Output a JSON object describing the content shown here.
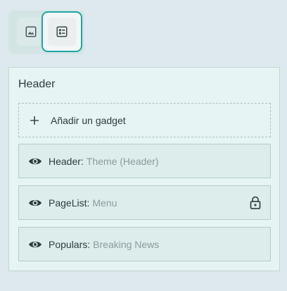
{
  "toolbar": {
    "buttons": [
      {
        "icon": "image-icon"
      },
      {
        "icon": "layout-icon",
        "selected": true
      }
    ]
  },
  "section": {
    "title": "Header",
    "add_gadget_label": "Añadir un gadget",
    "gadgets": [
      {
        "name": "Header:",
        "subtitle": "Theme (Header)",
        "visible": true,
        "locked": false
      },
      {
        "name": "PageList:",
        "subtitle": "Menu",
        "visible": true,
        "locked": true
      },
      {
        "name": "Populars:",
        "subtitle": "Breaking News",
        "visible": true,
        "locked": false
      }
    ]
  },
  "colors": {
    "accent": "#1ea5a5",
    "background": "#dde9ee",
    "section_bg": "#e6f4f4"
  }
}
